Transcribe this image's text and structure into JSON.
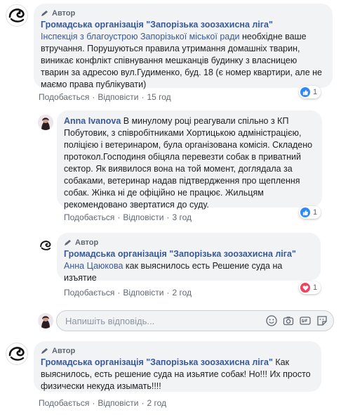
{
  "author_badge": "Автор",
  "comments": [
    {
      "author": "Громадська організація \"Запорізька зоозахисна ліга\"",
      "tag": "Інспекція з благоустрою Запорізької міської ради",
      "text": " необхідне ваше втручання. Порушуються правила утримання домашніх тварин, виникає конфлікт співнування мешканців будинку з власницею тварин за адресою вул.Гудименко, буд. 18 (є номер квартири, але не маємо права публікувати)",
      "like": "Подобається",
      "reply": "Відповісти",
      "time": "15 год",
      "reaction_count": "1",
      "reaction": "like-icon"
    },
    {
      "author": "Anna Ivanova",
      "text": " В минулому році реагували спільно з КП Побутовик, з співробітниками Хортицькою адміністрацією, поліцією і ветеринаром, була організована комісія. Складено протокол.Господиня обіцяла перевезти собак в приватний сектор. Як виявилося вона на той момент, доглядала за собаками, ветеринар надав підтвердження про щеплення собак. Жінка ні де офіційно не працює. Жильцям рекомендовано звертатися до суду.",
      "like": "Подобається",
      "reply": "Відповісти",
      "time": "3 год",
      "reaction_count": "1",
      "reaction": "like-icon"
    },
    {
      "author": "Громадська організація \"Запорізька зоозахисна ліга\"",
      "tag": "Анна Цаюкова",
      "text": " как выяснилось есть Решение суда на изъятие",
      "like": "Подобається",
      "reply": "Відповісти",
      "time": "2 год",
      "reaction_count": "1",
      "reaction": "love-icon"
    },
    {
      "author": "Громадська організація \"Запорізька зоозахисна ліга\"",
      "text": " Как выяснилось, есть решение суда на изьятие собак! Но!!! Их просто физически некуда изымать!!!!",
      "like": "Подобається",
      "reply": "Відповісти",
      "time": "2 год"
    }
  ],
  "reply_input": {
    "placeholder": "Напишіть відповідь..."
  },
  "colors": {
    "link": "#385898",
    "bubble": "#f2f3f5",
    "like": "#2d88ff",
    "love": "#f3425f"
  },
  "input_icons": [
    "emoji-icon",
    "camera-icon",
    "gif-icon",
    "sticker-icon"
  ]
}
